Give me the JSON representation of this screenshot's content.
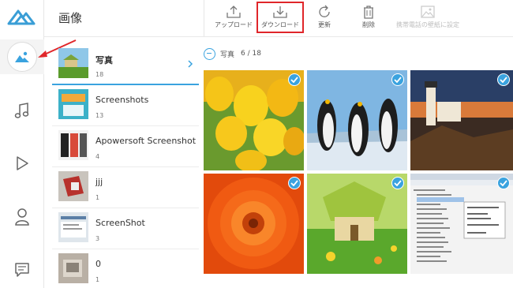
{
  "app": {
    "title": "画像"
  },
  "toolbar": {
    "update_label": "アップロード",
    "download_label": "ダウンロード",
    "refresh_label": "更新",
    "delete_label": "削除",
    "wallpaper_label": "携帯電話の壁紙に設定"
  },
  "albums": [
    {
      "name": "写真",
      "count": "18"
    },
    {
      "name": "Screenshots",
      "count": "13"
    },
    {
      "name": "Apowersoft Screenshot",
      "count": "4"
    },
    {
      "name": "jjj",
      "count": "1"
    },
    {
      "name": "ScreenShot",
      "count": "3"
    },
    {
      "name": "0",
      "count": "1"
    }
  ],
  "grid": {
    "album_name": "写真",
    "selection": "6 / 18"
  },
  "photos": [
    {
      "alt": "tulips"
    },
    {
      "alt": "penguins"
    },
    {
      "alt": "lighthouse"
    },
    {
      "alt": "flower"
    },
    {
      "alt": "cottage"
    },
    {
      "alt": "device manager screenshot"
    }
  ],
  "colors": {
    "accent": "#3aa3df",
    "highlight": "#e0262a"
  },
  "icons": [
    "logo-icon",
    "photo-icon",
    "music-icon",
    "video-icon",
    "contacts-icon",
    "message-icon",
    "upload-icon",
    "download-icon",
    "refresh-icon",
    "trash-icon",
    "image-icon",
    "chevron-right-icon",
    "minus-circle-icon",
    "check-icon"
  ]
}
